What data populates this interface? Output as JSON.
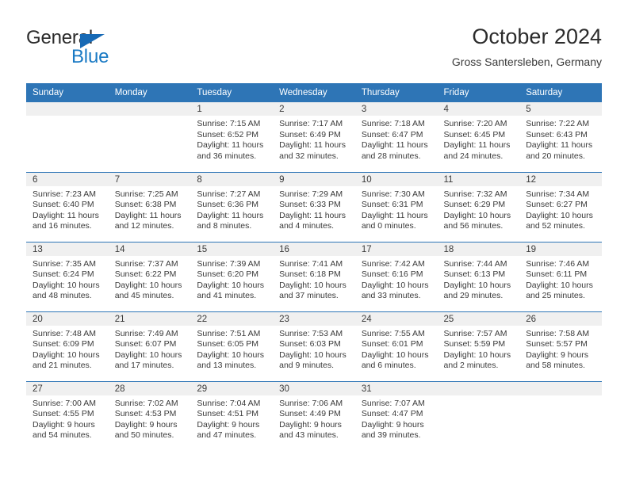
{
  "brand": {
    "name_part1": "General",
    "name_part2": "Blue",
    "triangle_color": "#1669b5",
    "blue_color": "#1a7ac4"
  },
  "header": {
    "title": "October 2024",
    "subtitle": "Gross Santersleben, Germany"
  },
  "theme": {
    "header_blue": "#2e75b6",
    "daynum_band": "#f0f0f0",
    "text": "#3a3a3a"
  },
  "weekdays": [
    "Sunday",
    "Monday",
    "Tuesday",
    "Wednesday",
    "Thursday",
    "Friday",
    "Saturday"
  ],
  "weeks": [
    [
      {
        "day": "",
        "sunrise": "",
        "sunset": "",
        "daylight1": "",
        "daylight2": ""
      },
      {
        "day": "",
        "sunrise": "",
        "sunset": "",
        "daylight1": "",
        "daylight2": ""
      },
      {
        "day": "1",
        "sunrise": "Sunrise: 7:15 AM",
        "sunset": "Sunset: 6:52 PM",
        "daylight1": "Daylight: 11 hours",
        "daylight2": "and 36 minutes."
      },
      {
        "day": "2",
        "sunrise": "Sunrise: 7:17 AM",
        "sunset": "Sunset: 6:49 PM",
        "daylight1": "Daylight: 11 hours",
        "daylight2": "and 32 minutes."
      },
      {
        "day": "3",
        "sunrise": "Sunrise: 7:18 AM",
        "sunset": "Sunset: 6:47 PM",
        "daylight1": "Daylight: 11 hours",
        "daylight2": "and 28 minutes."
      },
      {
        "day": "4",
        "sunrise": "Sunrise: 7:20 AM",
        "sunset": "Sunset: 6:45 PM",
        "daylight1": "Daylight: 11 hours",
        "daylight2": "and 24 minutes."
      },
      {
        "day": "5",
        "sunrise": "Sunrise: 7:22 AM",
        "sunset": "Sunset: 6:43 PM",
        "daylight1": "Daylight: 11 hours",
        "daylight2": "and 20 minutes."
      }
    ],
    [
      {
        "day": "6",
        "sunrise": "Sunrise: 7:23 AM",
        "sunset": "Sunset: 6:40 PM",
        "daylight1": "Daylight: 11 hours",
        "daylight2": "and 16 minutes."
      },
      {
        "day": "7",
        "sunrise": "Sunrise: 7:25 AM",
        "sunset": "Sunset: 6:38 PM",
        "daylight1": "Daylight: 11 hours",
        "daylight2": "and 12 minutes."
      },
      {
        "day": "8",
        "sunrise": "Sunrise: 7:27 AM",
        "sunset": "Sunset: 6:36 PM",
        "daylight1": "Daylight: 11 hours",
        "daylight2": "and 8 minutes."
      },
      {
        "day": "9",
        "sunrise": "Sunrise: 7:29 AM",
        "sunset": "Sunset: 6:33 PM",
        "daylight1": "Daylight: 11 hours",
        "daylight2": "and 4 minutes."
      },
      {
        "day": "10",
        "sunrise": "Sunrise: 7:30 AM",
        "sunset": "Sunset: 6:31 PM",
        "daylight1": "Daylight: 11 hours",
        "daylight2": "and 0 minutes."
      },
      {
        "day": "11",
        "sunrise": "Sunrise: 7:32 AM",
        "sunset": "Sunset: 6:29 PM",
        "daylight1": "Daylight: 10 hours",
        "daylight2": "and 56 minutes."
      },
      {
        "day": "12",
        "sunrise": "Sunrise: 7:34 AM",
        "sunset": "Sunset: 6:27 PM",
        "daylight1": "Daylight: 10 hours",
        "daylight2": "and 52 minutes."
      }
    ],
    [
      {
        "day": "13",
        "sunrise": "Sunrise: 7:35 AM",
        "sunset": "Sunset: 6:24 PM",
        "daylight1": "Daylight: 10 hours",
        "daylight2": "and 48 minutes."
      },
      {
        "day": "14",
        "sunrise": "Sunrise: 7:37 AM",
        "sunset": "Sunset: 6:22 PM",
        "daylight1": "Daylight: 10 hours",
        "daylight2": "and 45 minutes."
      },
      {
        "day": "15",
        "sunrise": "Sunrise: 7:39 AM",
        "sunset": "Sunset: 6:20 PM",
        "daylight1": "Daylight: 10 hours",
        "daylight2": "and 41 minutes."
      },
      {
        "day": "16",
        "sunrise": "Sunrise: 7:41 AM",
        "sunset": "Sunset: 6:18 PM",
        "daylight1": "Daylight: 10 hours",
        "daylight2": "and 37 minutes."
      },
      {
        "day": "17",
        "sunrise": "Sunrise: 7:42 AM",
        "sunset": "Sunset: 6:16 PM",
        "daylight1": "Daylight: 10 hours",
        "daylight2": "and 33 minutes."
      },
      {
        "day": "18",
        "sunrise": "Sunrise: 7:44 AM",
        "sunset": "Sunset: 6:13 PM",
        "daylight1": "Daylight: 10 hours",
        "daylight2": "and 29 minutes."
      },
      {
        "day": "19",
        "sunrise": "Sunrise: 7:46 AM",
        "sunset": "Sunset: 6:11 PM",
        "daylight1": "Daylight: 10 hours",
        "daylight2": "and 25 minutes."
      }
    ],
    [
      {
        "day": "20",
        "sunrise": "Sunrise: 7:48 AM",
        "sunset": "Sunset: 6:09 PM",
        "daylight1": "Daylight: 10 hours",
        "daylight2": "and 21 minutes."
      },
      {
        "day": "21",
        "sunrise": "Sunrise: 7:49 AM",
        "sunset": "Sunset: 6:07 PM",
        "daylight1": "Daylight: 10 hours",
        "daylight2": "and 17 minutes."
      },
      {
        "day": "22",
        "sunrise": "Sunrise: 7:51 AM",
        "sunset": "Sunset: 6:05 PM",
        "daylight1": "Daylight: 10 hours",
        "daylight2": "and 13 minutes."
      },
      {
        "day": "23",
        "sunrise": "Sunrise: 7:53 AM",
        "sunset": "Sunset: 6:03 PM",
        "daylight1": "Daylight: 10 hours",
        "daylight2": "and 9 minutes."
      },
      {
        "day": "24",
        "sunrise": "Sunrise: 7:55 AM",
        "sunset": "Sunset: 6:01 PM",
        "daylight1": "Daylight: 10 hours",
        "daylight2": "and 6 minutes."
      },
      {
        "day": "25",
        "sunrise": "Sunrise: 7:57 AM",
        "sunset": "Sunset: 5:59 PM",
        "daylight1": "Daylight: 10 hours",
        "daylight2": "and 2 minutes."
      },
      {
        "day": "26",
        "sunrise": "Sunrise: 7:58 AM",
        "sunset": "Sunset: 5:57 PM",
        "daylight1": "Daylight: 9 hours",
        "daylight2": "and 58 minutes."
      }
    ],
    [
      {
        "day": "27",
        "sunrise": "Sunrise: 7:00 AM",
        "sunset": "Sunset: 4:55 PM",
        "daylight1": "Daylight: 9 hours",
        "daylight2": "and 54 minutes."
      },
      {
        "day": "28",
        "sunrise": "Sunrise: 7:02 AM",
        "sunset": "Sunset: 4:53 PM",
        "daylight1": "Daylight: 9 hours",
        "daylight2": "and 50 minutes."
      },
      {
        "day": "29",
        "sunrise": "Sunrise: 7:04 AM",
        "sunset": "Sunset: 4:51 PM",
        "daylight1": "Daylight: 9 hours",
        "daylight2": "and 47 minutes."
      },
      {
        "day": "30",
        "sunrise": "Sunrise: 7:06 AM",
        "sunset": "Sunset: 4:49 PM",
        "daylight1": "Daylight: 9 hours",
        "daylight2": "and 43 minutes."
      },
      {
        "day": "31",
        "sunrise": "Sunrise: 7:07 AM",
        "sunset": "Sunset: 4:47 PM",
        "daylight1": "Daylight: 9 hours",
        "daylight2": "and 39 minutes."
      },
      {
        "day": "",
        "sunrise": "",
        "sunset": "",
        "daylight1": "",
        "daylight2": ""
      },
      {
        "day": "",
        "sunrise": "",
        "sunset": "",
        "daylight1": "",
        "daylight2": ""
      }
    ]
  ]
}
